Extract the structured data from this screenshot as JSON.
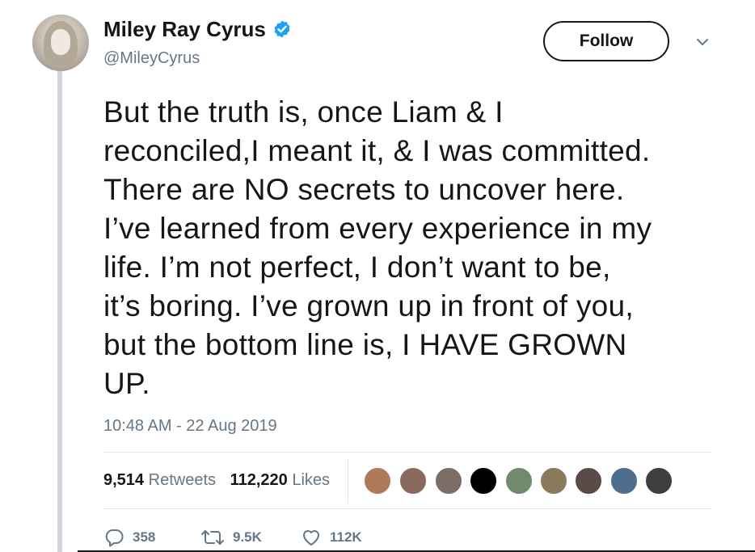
{
  "user": {
    "name": "Miley Ray Cyrus",
    "handle": "@MileyCyrus",
    "verified": true
  },
  "follow_label": "Follow",
  "tweet": {
    "lines": [
      "But the truth is, once Liam & I",
      "reconciled,I meant it, & I was committed.",
      "There are NO secrets to uncover here.",
      "I’ve learned from every experience in my",
      "life. I’m not perfect, I don’t want to be,",
      "it’s boring. I’ve grown up in front of you,",
      "but the bottom line is, I HAVE GROWN",
      "UP."
    ],
    "timestamp": "10:48 AM - 22 Aug 2019"
  },
  "stats": {
    "retweets_count": "9,514",
    "retweets_label": "Retweets",
    "likes_count": "112,220",
    "likes_label": "Likes"
  },
  "likers": [
    {
      "name": "liker-avatar-1",
      "color": "#b07a5a"
    },
    {
      "name": "liker-avatar-2",
      "color": "#8a6a5c"
    },
    {
      "name": "liker-avatar-3",
      "color": "#7c6e66"
    },
    {
      "name": "liker-avatar-4",
      "color": "#000000"
    },
    {
      "name": "liker-avatar-5",
      "color": "#6f8a6d"
    },
    {
      "name": "liker-avatar-6",
      "color": "#8b7a5c"
    },
    {
      "name": "liker-avatar-7",
      "color": "#5a4a48"
    },
    {
      "name": "liker-avatar-8",
      "color": "#4d6e8c"
    },
    {
      "name": "liker-avatar-9",
      "color": "#3e3e3e"
    }
  ],
  "actions": {
    "reply_count": "358",
    "retweet_count": "9.5K",
    "like_count": "112K"
  },
  "colors": {
    "verified_blue": "#1da1f2",
    "secondary_text": "#657786",
    "primary_text": "#14171a",
    "thread_line": "#cfd5db"
  },
  "icons": [
    "verified-badge-icon",
    "chevron-down-icon",
    "reply-icon",
    "retweet-icon",
    "heart-icon"
  ]
}
